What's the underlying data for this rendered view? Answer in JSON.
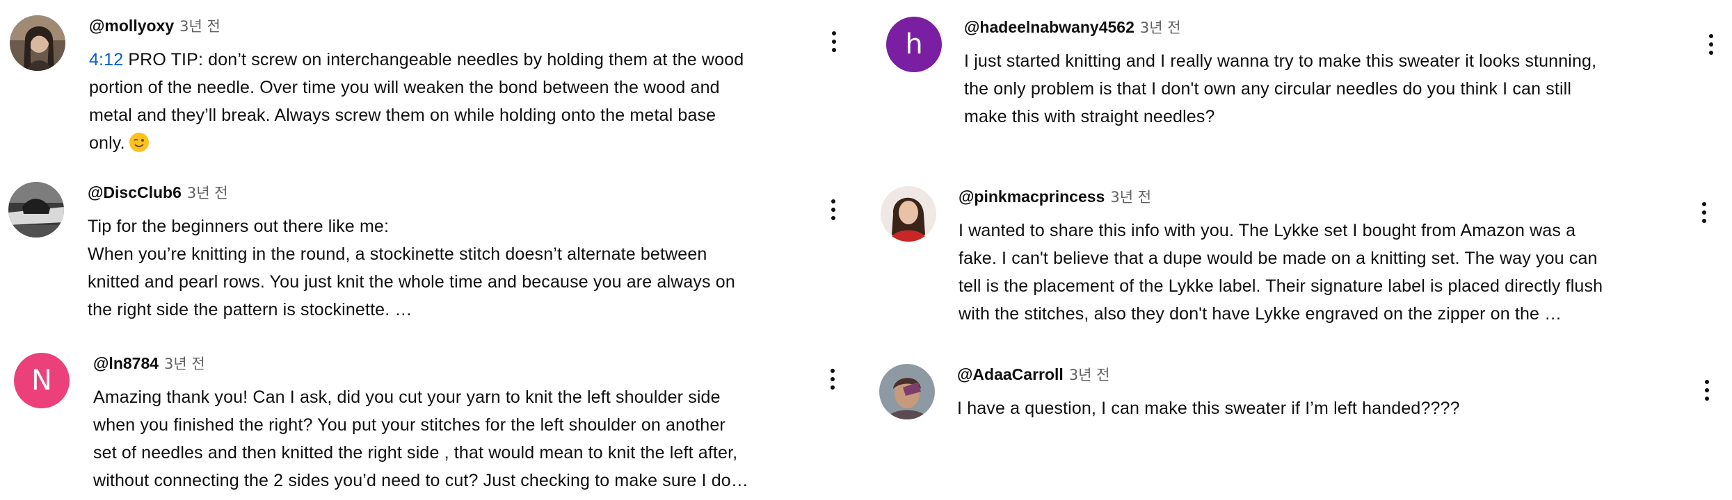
{
  "comments": [
    {
      "handle": "@mollyoxy",
      "time": "3년 전",
      "timestamp": "4:12",
      "lines": [
        " PRO TIP: don’t screw on interchangeable needles by holding them at the wood",
        "portion of the needle. Over time you will weaken the bond between the wood and",
        "metal and they’ll break. Always screw them on while holding onto the metal base",
        "only."
      ],
      "emoji": "wink-emoji",
      "avatar_icon": "photo-avatar-icon"
    },
    {
      "handle": "@DiscClub6",
      "time": "3년 전",
      "lines": [
        "Tip for the beginners out there like me:",
        "When you’re knitting in the round, a stockinette stitch doesn’t alternate between",
        "knitted and pearl rows. You just knit the whole time and because you are always on",
        "the right side the pattern is stockinette. …"
      ],
      "avatar_icon": "photo-avatar-icon"
    },
    {
      "handle": "@ln8784",
      "time": "3년 전",
      "avatar_letter": "N",
      "avatar_color": "#ec407a",
      "lines": [
        "Amazing thank you! Can I ask, did you cut your yarn to knit the left shoulder side",
        "when you finished the right? You put your stitches for the left shoulder on another",
        "set of needles and then knitted the right side , that would mean to knit the left after,",
        "without connecting the 2 sides you’d need to cut? Just checking to make sure I do…"
      ]
    },
    {
      "handle": "@hadeelnabwany4562",
      "time": "3년 전",
      "avatar_letter": "h",
      "avatar_color": "#7b1fa2",
      "lines": [
        "I just started knitting and I really wanna try to make this sweater it looks stunning,",
        "the only problem is that I don't own any circular needles do you think I can still",
        "make this with straight needles?"
      ]
    },
    {
      "handle": "@pinkmacprincess",
      "time": "3년 전",
      "lines": [
        "I wanted to share this info with you. The Lykke set I bought from Amazon was a",
        "fake. I can't  believe that a dupe would be made on a knitting set. The way you can",
        "tell is the placement of the Lykke label. Their signature label is placed directly flush",
        "with the stitches, also they don't have Lykke engraved on the zipper on the …"
      ],
      "avatar_icon": "photo-avatar-icon"
    },
    {
      "handle": "@AdaaCarroll",
      "time": "3년 전",
      "lines": [
        "I have a question, I can make this sweater if I’m left handed????"
      ],
      "avatar_icon": "photo-avatar-icon"
    }
  ],
  "menu_icon": "more-vert-icon"
}
